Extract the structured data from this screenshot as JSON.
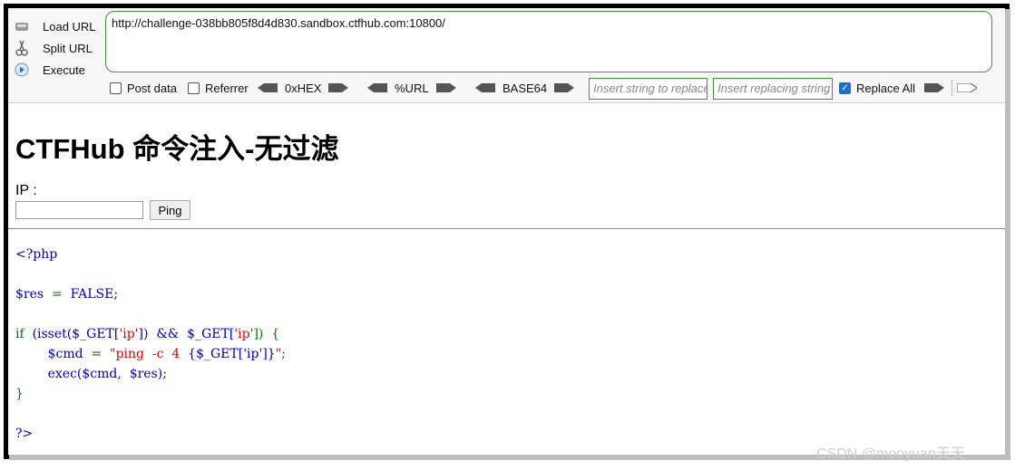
{
  "hackbar": {
    "load_url": "Load URL",
    "split_url": "Split URL",
    "execute": "Execute",
    "url": "http://challenge-038bb805f8d4d830.sandbox.ctfhub.com:10800/",
    "post_data": "Post data",
    "referrer": "Referrer",
    "hex": "0xHEX",
    "urlenc": "%URL",
    "base64": "BASE64",
    "insert_placeholder": "Insert string to replace",
    "replacing_placeholder": "Insert replacing string",
    "replace_all": "Replace All",
    "post_data_checked": false,
    "referrer_checked": false,
    "replace_all_checked": true
  },
  "page": {
    "title": "CTFHub 命令注入-无过滤",
    "ip_label": "IP :",
    "ping_button": "Ping",
    "ip_value": ""
  },
  "code": {
    "l1": "<?php",
    "l2_var": "$res",
    "l2_eq": "  =  ",
    "l2_val": "FALSE;",
    "l3_if": "if  ",
    "l3_a": "(isset(",
    "l3_b": "$_GET[",
    "l3_c": "'ip'",
    "l3_d": "])  &&  ",
    "l3_e": "$_GET[",
    "l3_f": "'ip'",
    "l3_g": "])  {",
    "l4_var": "        $cmd",
    "l4_eq": "  =  ",
    "l4_str": "\"ping  -c  4  ",
    "l4_inner": "{$_GET['ip']}",
    "l4_end": "\"",
    "l4_semi": ";",
    "l5": "        exec($cmd,  $res);",
    "l6": "}",
    "l7": "?>"
  },
  "watermark": "CSDN @mooyuan天天",
  "colors": {
    "accent_green": "#3a9a3a",
    "php_blue": "#0000bb",
    "php_green": "#007700",
    "php_red": "#dd0000"
  }
}
